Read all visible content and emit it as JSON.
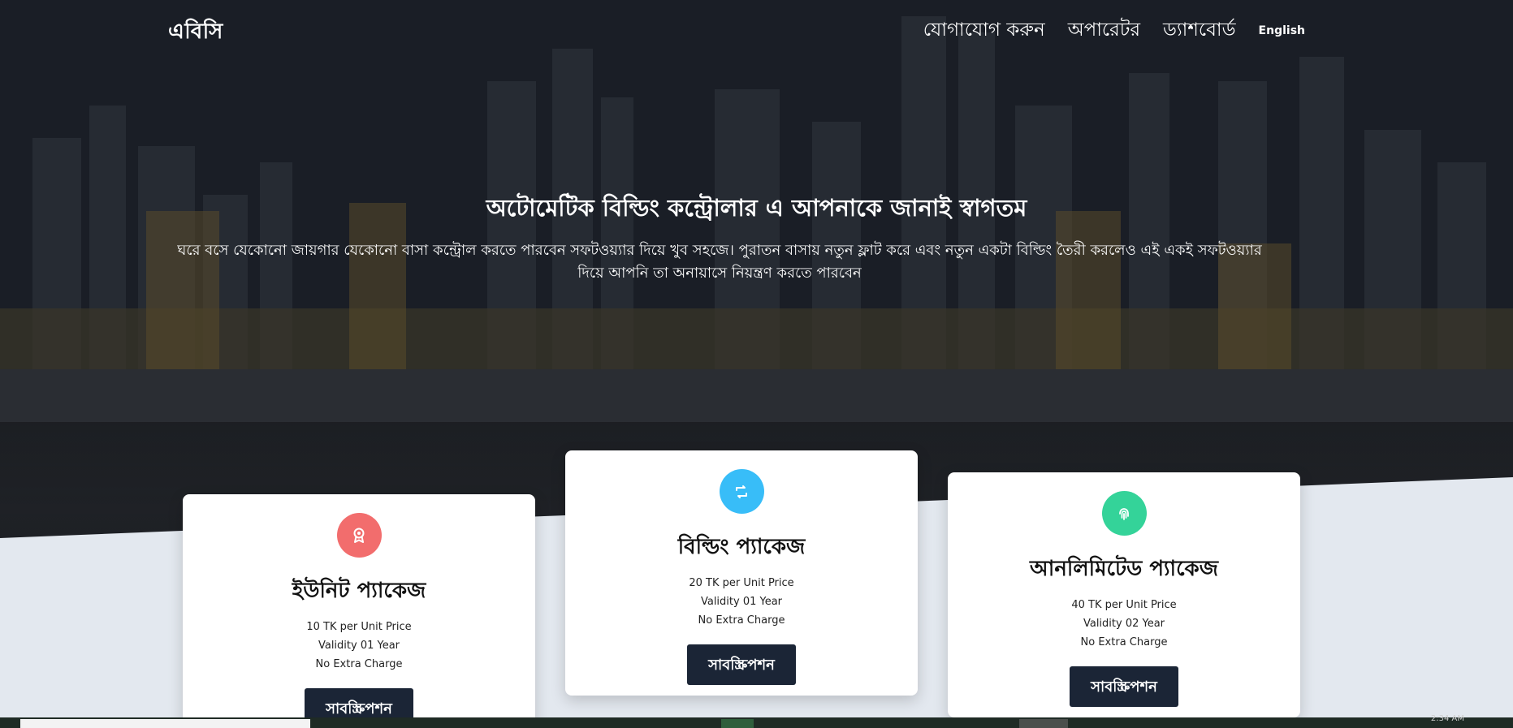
{
  "header": {
    "brand": "এবিসি",
    "nav": [
      {
        "label": "যোগাযোগ করুন"
      },
      {
        "label": "অপারেটর"
      },
      {
        "label": "ড্যাশবোর্ড"
      },
      {
        "label": "English"
      }
    ]
  },
  "hero": {
    "title": "অটোমেটিক বিল্ডিং কন্ট্রোলার এ আপনাকে জানাই স্বাগতম",
    "subtitle": "ঘরে বসে যেকোনো জায়গার যেকোনো বাসা কন্ট্রোল করতে পারবেন সফটওয়্যার দিয়ে খুব সহজে। পুরাতন বাসায় নতুন ফ্লাট করে এবং নতুন একটা বিল্ডিং তৈরী করলেও এই একই সফটওয়্যার দিয়ে আপনি তা অনায়াসে নিয়ন্ত্রণ করতে পারবেন"
  },
  "packages": [
    {
      "icon": "award-icon",
      "icon_color": "#f26d6d",
      "title": "ইউনিট প্যাকেজ",
      "price": "10 TK per Unit Price",
      "validity": "Validity 01 Year",
      "extra": "No Extra Charge",
      "button": "সাবস্ক্রিপশন"
    },
    {
      "icon": "refresh-icon",
      "icon_color": "#38bdf8",
      "title": "বিল্ডিং প্যাকেজ",
      "price": "20 TK per Unit Price",
      "validity": "Validity 01 Year",
      "extra": "No Extra Charge",
      "button": "সাবস্ক্রিপশন"
    },
    {
      "icon": "fingerprint-icon",
      "icon_color": "#34d399",
      "title": "আনলিমিটেড প্যাকেজ",
      "price": "40 TK per Unit Price",
      "validity": "Validity 02 Year",
      "extra": "No Extra Charge",
      "button": "সাবস্ক্রিপশন"
    }
  ],
  "taskbar": {
    "clock": "2:34 AM"
  }
}
